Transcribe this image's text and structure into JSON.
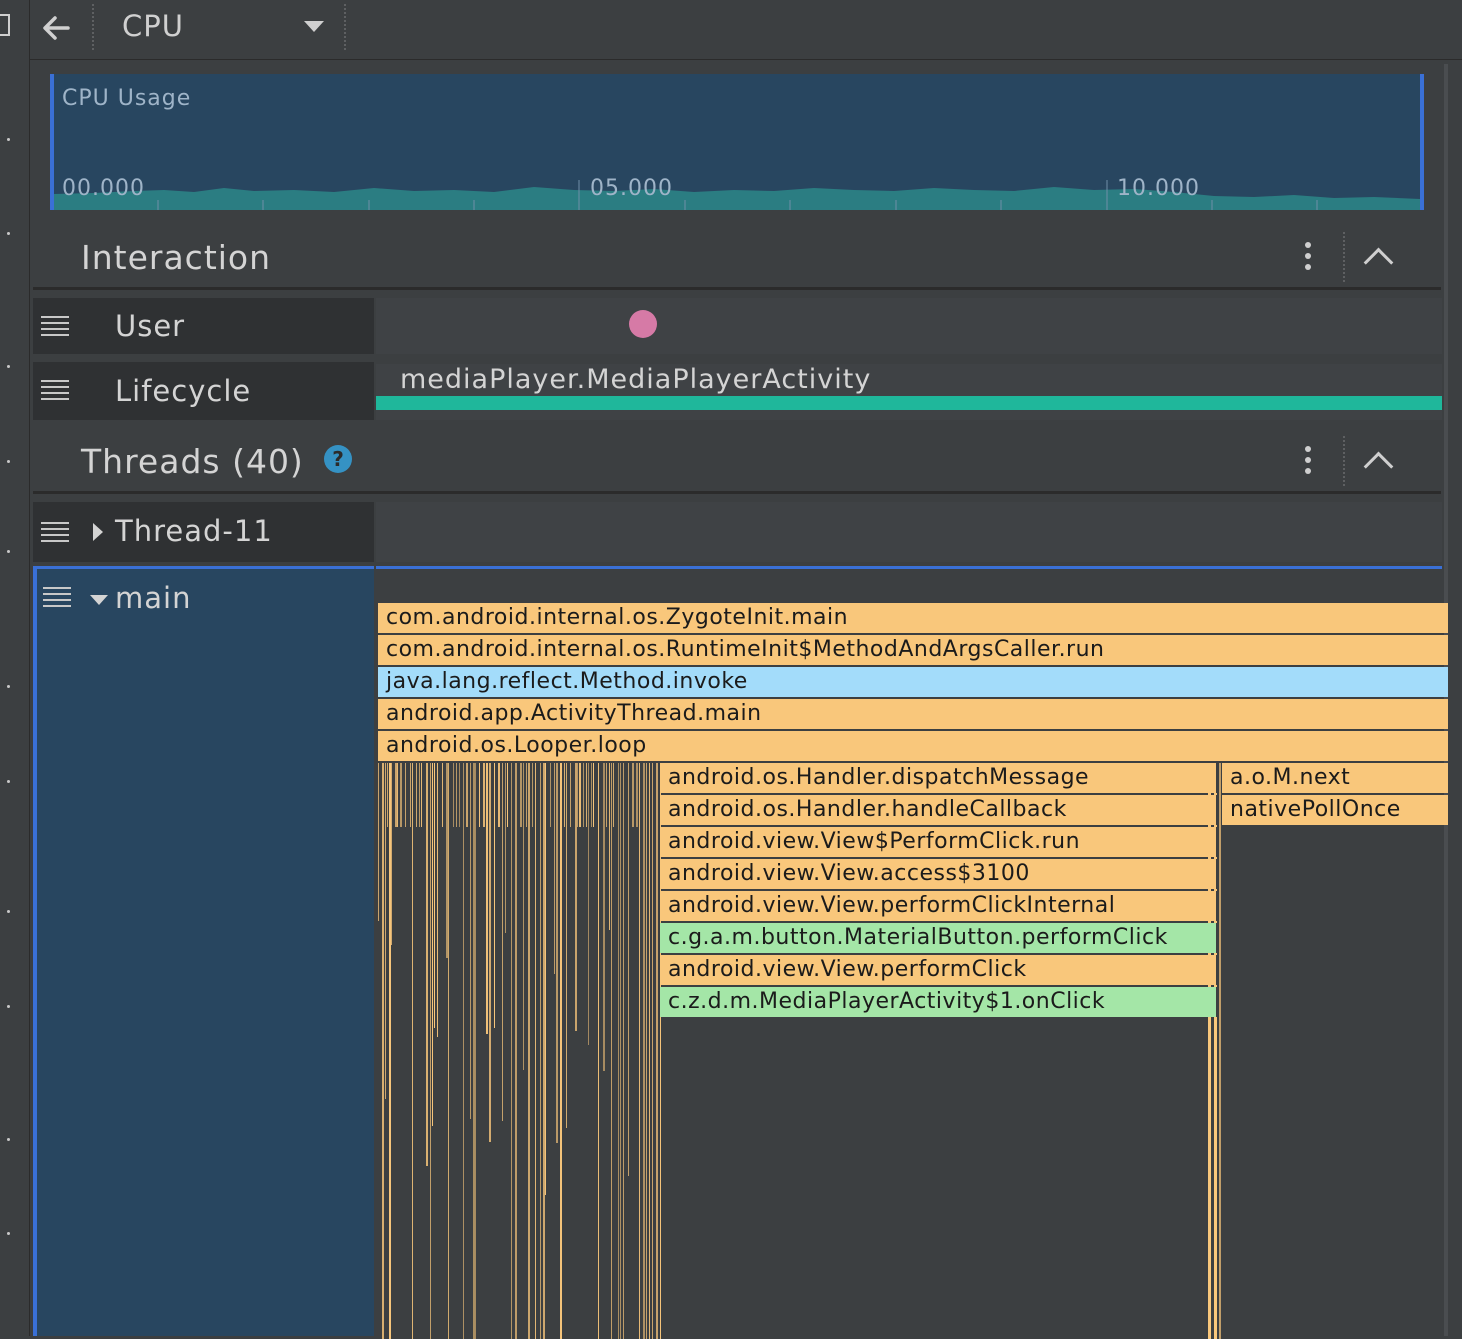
{
  "toolbar": {
    "back_icon": "arrow-left-icon",
    "profiler_select": "CPU",
    "dropdown_icon": "triangle-down-icon"
  },
  "cpu_usage": {
    "title": "CPU Usage",
    "ticks": [
      "00.000",
      "05.000",
      "10.000"
    ],
    "fill_color": "#2b7d82",
    "background_color": "#284660"
  },
  "interaction": {
    "title": "Interaction",
    "rows": [
      {
        "label": "User"
      },
      {
        "label": "Lifecycle",
        "activity": "mediaPlayer.MediaPlayerActivity"
      }
    ],
    "user_event_color": "#d67aa6",
    "lifecycle_bar_color": "#1fb79b"
  },
  "threads": {
    "title": "Threads (40)",
    "help_icon": "question-circle-icon",
    "rows": [
      {
        "label": "Thread-11",
        "expanded": false
      },
      {
        "label": "main",
        "expanded": true
      }
    ]
  },
  "flame": {
    "frames": [
      {
        "label": "com.android.internal.os.ZygoteInit.main",
        "kind": "orange"
      },
      {
        "label": "com.android.internal.os.RuntimeInit$MethodAndArgsCaller.run",
        "kind": "orange"
      },
      {
        "label": "java.lang.reflect.Method.invoke",
        "kind": "blue"
      },
      {
        "label": "android.app.ActivityThread.main",
        "kind": "orange"
      },
      {
        "label": "android.os.Looper.loop",
        "kind": "orange"
      },
      {
        "label": "android.os.Handler.dispatchMessage",
        "kind": "orange"
      },
      {
        "label": "android.os.Handler.handleCallback",
        "kind": "orange"
      },
      {
        "label": "android.view.View$PerformClick.run",
        "kind": "orange"
      },
      {
        "label": "android.view.View.access$3100",
        "kind": "orange"
      },
      {
        "label": "android.view.View.performClickInternal",
        "kind": "orange"
      },
      {
        "label": "c.g.a.m.button.MaterialButton.performClick",
        "kind": "green"
      },
      {
        "label": "android.view.View.performClick",
        "kind": "orange"
      },
      {
        "label": "c.z.d.m.MediaPlayerActivity$1.onClick",
        "kind": "green"
      },
      {
        "label": "a.o.M.next",
        "kind": "orange"
      },
      {
        "label": "nativePollOnce",
        "kind": "orange"
      }
    ],
    "colors": {
      "orange": "#f9c77b",
      "blue": "#a3dcfa",
      "green": "#a4e6a7"
    }
  }
}
